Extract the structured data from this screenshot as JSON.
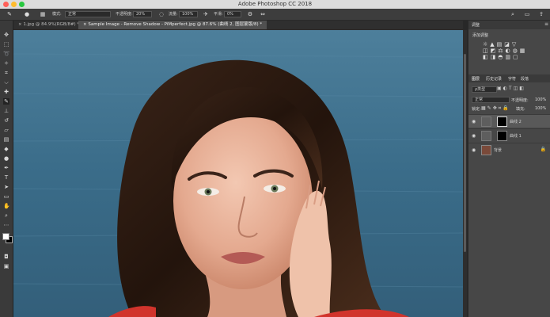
{
  "window": {
    "title": "Adobe Photoshop CC 2018"
  },
  "options_bar": {
    "mode_label": "模式:",
    "mode_value": "正常",
    "opacity_label": "不透明度:",
    "opacity_value": "20%",
    "flow_label": "流量:",
    "flow_value": "100%",
    "smoothing_label": "平滑:",
    "smoothing_value": "0%"
  },
  "tabs": [
    {
      "label": "1.jpg @ 84.9%(RGB/8#) *"
    },
    {
      "label": "Sample Image - Remove Shadow - PiMperfect.jpg @ 87.6% (曲线 2, 图层蒙版/8) *"
    }
  ],
  "adjustments_panel": {
    "title": "调整",
    "subtitle": "添加调整"
  },
  "layers_panel": {
    "tabs": [
      "图层",
      "历史记录",
      "字符",
      "段落"
    ],
    "filter_value": "ρ类型",
    "blend_mode": "正常",
    "opacity_label": "不透明度:",
    "opacity_value": "100%",
    "lock_label": "锁定:",
    "fill_label": "填充:",
    "fill_value": "100%",
    "layers": [
      {
        "name": "曲线 2",
        "selected": true
      },
      {
        "name": "曲线 1",
        "selected": false
      },
      {
        "name": "背景",
        "selected": false
      }
    ]
  },
  "colors": {
    "accent": "#ff5f57",
    "ui_bg": "#474747"
  }
}
